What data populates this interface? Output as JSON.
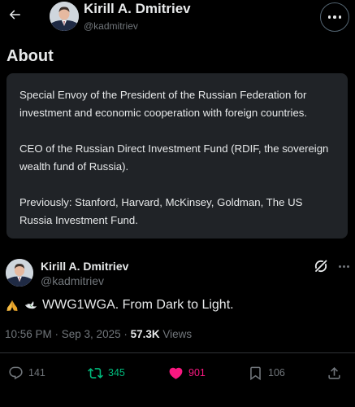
{
  "header": {
    "name": "Kirill A. Dmitriev",
    "handle": "@kadmitriev",
    "back_icon": "arrow-left-icon",
    "more_icon": "more-horizontal-icon"
  },
  "about": {
    "title": "About",
    "paragraphs": [
      "Special Envoy of the President of the Russian Federation for investment and economic cooperation with foreign countries.",
      "CEO of the Russian Direct Investment Fund (RDIF, the sovereign wealth fund of Russia).",
      "Previously: Stanford, Harvard, McKinsey, Goldman, The US Russia Investment Fund."
    ]
  },
  "post": {
    "author_name": "Kirill A. Dmitriev",
    "author_handle": "@kadmitriev",
    "emojis": [
      "folded-hands-emoji",
      "dove-emoji"
    ],
    "text": "WWG1WGA. From Dark to Light.",
    "timestamp": "10:56 PM · Sep 3, 2025",
    "separator": " · ",
    "views_count": "57.3K",
    "views_label": "Views",
    "actions": {
      "reply_count": "141",
      "repost_count": "345",
      "like_count": "901",
      "bookmark_count": "106"
    }
  },
  "colors": {
    "background": "#000000",
    "card": "#202327",
    "text": "#e7e9ea",
    "muted": "#71767b",
    "repost": "#00ba7c",
    "like": "#f91880"
  }
}
